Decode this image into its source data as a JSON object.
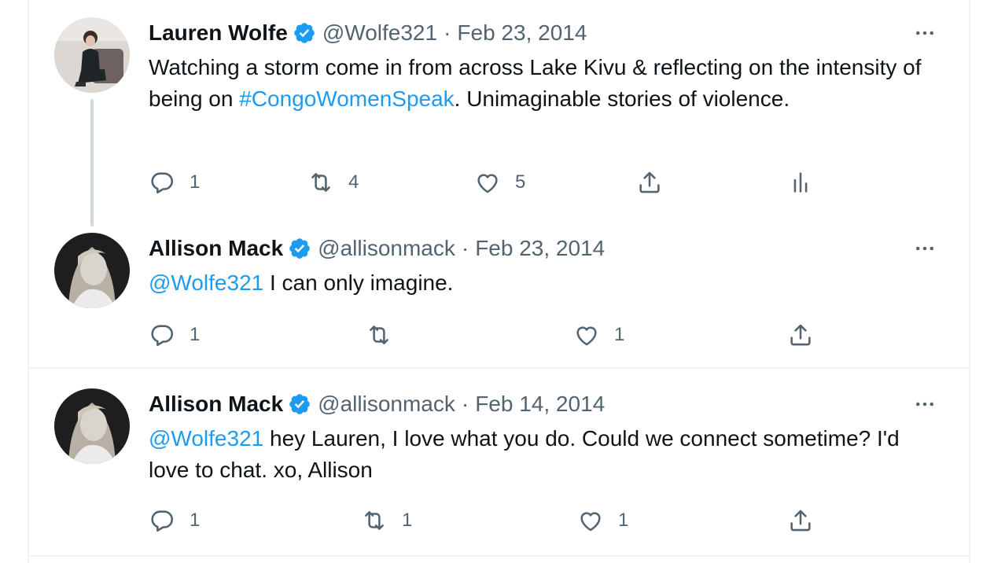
{
  "tweets": [
    {
      "author": "Lauren Wolfe",
      "handle": "@Wolfe321",
      "separator": "·",
      "date": "Feb 23, 2014",
      "text_parts": {
        "part1": "Watching a storm come in from across Lake Kivu & reflecting on the intensity of being on ",
        "hashtag": "#CongoWomenSpeak",
        "part2": ". Unimaginable stories of violence."
      },
      "replies": "1",
      "retweets": "4",
      "likes": "5",
      "icons": [
        "reply-icon",
        "retweet-icon",
        "like-icon",
        "share-icon",
        "analytics-icon"
      ]
    },
    {
      "author": "Allison Mack",
      "handle": "@allisonmack",
      "separator": "·",
      "date": "Feb 23, 2014",
      "text_parts": {
        "mention": "@Wolfe321",
        "part1": " I can only imagine."
      },
      "replies": "1",
      "retweets": "",
      "likes": "1",
      "icons": [
        "reply-icon",
        "retweet-icon",
        "like-icon",
        "share-icon"
      ]
    },
    {
      "author": "Allison Mack",
      "handle": "@allisonmack",
      "separator": "·",
      "date": "Feb 14, 2014",
      "text_parts": {
        "mention": "@Wolfe321",
        "part1": " hey Lauren, I love what you do. Could we connect sometime? I'd love to chat. xo, Allison"
      },
      "replies": "1",
      "retweets": "1",
      "likes": "1",
      "icons": [
        "reply-icon",
        "retweet-icon",
        "like-icon",
        "share-icon"
      ]
    }
  ],
  "colors": {
    "link": "#1d9bf0",
    "secondary_text": "#536471",
    "verified_badge": "#1d9bf0",
    "border": "#eff3f4",
    "thread_line": "#cfd9de"
  }
}
